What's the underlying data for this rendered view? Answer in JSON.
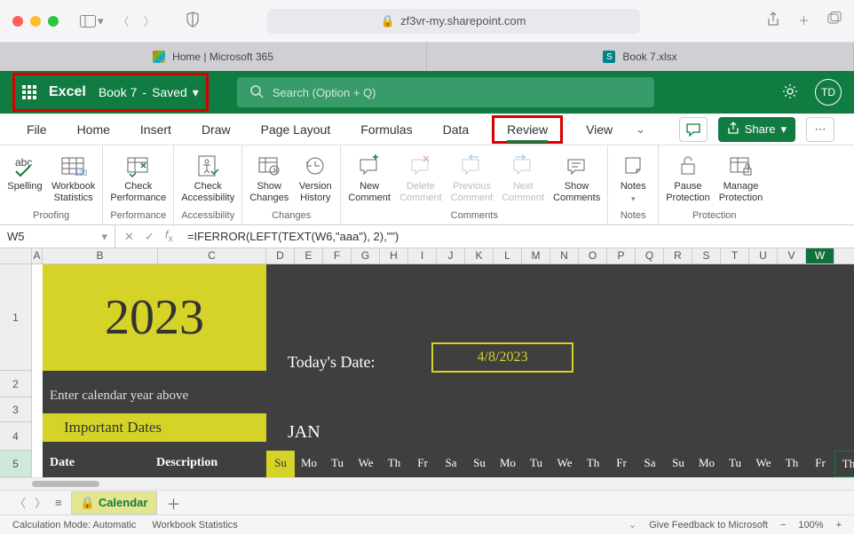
{
  "browser": {
    "url_host": "zf3vr-my.sharepoint.com",
    "tabs": [
      {
        "label": "Home | Microsoft 365"
      },
      {
        "label": "Book 7.xlsx"
      }
    ]
  },
  "title": {
    "app": "Excel",
    "file": "Book 7",
    "status": "Saved",
    "search_placeholder": "Search (Option + Q)",
    "avatar_initials": "TD"
  },
  "menu": {
    "items": [
      "File",
      "Home",
      "Insert",
      "Draw",
      "Page Layout",
      "Formulas",
      "Data",
      "Review",
      "View"
    ],
    "active": "Review",
    "share_label": "Share"
  },
  "ribbon": {
    "groups": [
      {
        "name": "Proofing",
        "items": [
          {
            "label": "Spelling"
          },
          {
            "label": "Workbook\nStatistics"
          }
        ]
      },
      {
        "name": "Performance",
        "items": [
          {
            "label": "Check\nPerformance"
          }
        ]
      },
      {
        "name": "Accessibility",
        "items": [
          {
            "label": "Check\nAccessibility"
          }
        ]
      },
      {
        "name": "Changes",
        "items": [
          {
            "label": "Show\nChanges"
          },
          {
            "label": "Version\nHistory"
          }
        ]
      },
      {
        "name": "Comments",
        "items": [
          {
            "label": "New\nComment"
          },
          {
            "label": "Delete\nComment",
            "disabled": true
          },
          {
            "label": "Previous\nComment",
            "disabled": true
          },
          {
            "label": "Next\nComment",
            "disabled": true
          },
          {
            "label": "Show\nComments"
          }
        ]
      },
      {
        "name": "Notes",
        "items": [
          {
            "label": "Notes"
          }
        ]
      },
      {
        "name": "Protection",
        "items": [
          {
            "label": "Pause\nProtection"
          },
          {
            "label": "Manage\nProtection"
          }
        ]
      }
    ]
  },
  "formula": {
    "name_box": "W5",
    "formula_text": "=IFERROR(LEFT(TEXT(W6,\"aaa\"), 2),\"\")"
  },
  "sheet": {
    "cols": [
      "A",
      "B",
      "C",
      "D",
      "E",
      "F",
      "G",
      "H",
      "I",
      "J",
      "K",
      "L",
      "M",
      "N",
      "O",
      "P",
      "Q",
      "R",
      "S",
      "T",
      "U",
      "V",
      "W"
    ],
    "active_col": "W",
    "rows": [
      "1",
      "2",
      "3",
      "4",
      "5"
    ],
    "calendar": {
      "year": "2023",
      "today_label": "Today's Date:",
      "today_date": "4/8/2023",
      "enter_year": "Enter calendar year above",
      "important_dates": "Important Dates",
      "month": "JAN",
      "date_header": "Date",
      "desc_header": "Description",
      "days": [
        "Su",
        "Mo",
        "Tu",
        "We",
        "Th",
        "Fr",
        "Sa",
        "Su",
        "Mo",
        "Tu",
        "We",
        "Th",
        "Fr",
        "Sa",
        "Su",
        "Mo",
        "Tu",
        "We",
        "Th",
        "Fr",
        "Th"
      ]
    },
    "tab_name": "Calendar"
  },
  "status": {
    "calc_mode": "Calculation Mode: Automatic",
    "workbook_stats": "Workbook Statistics",
    "feedback": "Give Feedback to Microsoft",
    "zoom": "100%"
  }
}
